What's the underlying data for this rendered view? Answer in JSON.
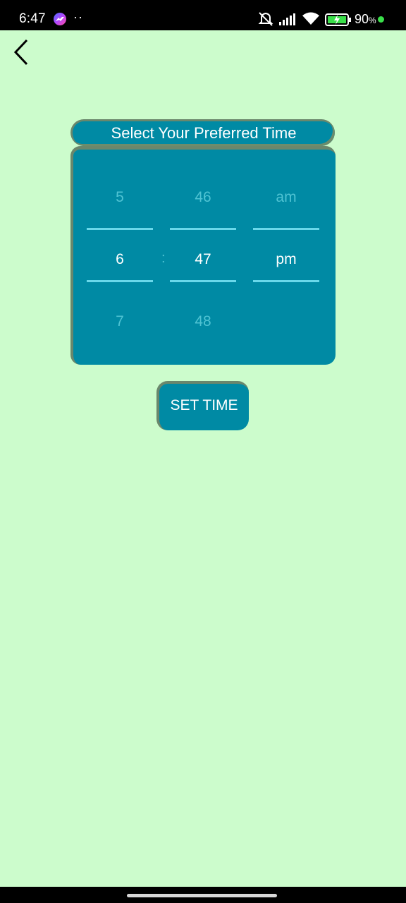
{
  "status_bar": {
    "time": "6:47",
    "overflow_dots": "··",
    "battery_percent": "90",
    "battery_unit": "%"
  },
  "header": {
    "back_icon": "chevron-left-icon"
  },
  "picker": {
    "title": "Select Your Preferred Time",
    "separator": ":",
    "hours": {
      "above": "5",
      "selected": "6",
      "below": "7"
    },
    "minutes": {
      "above": "46",
      "selected": "47",
      "below": "48"
    },
    "period": {
      "above": "am",
      "selected": "pm"
    }
  },
  "actions": {
    "set_time_label": "SET TIME"
  },
  "colors": {
    "background": "#ccfccc",
    "accent": "#008aa4",
    "divider": "#6ad8ea",
    "faded_text": "#4fc3d3"
  }
}
